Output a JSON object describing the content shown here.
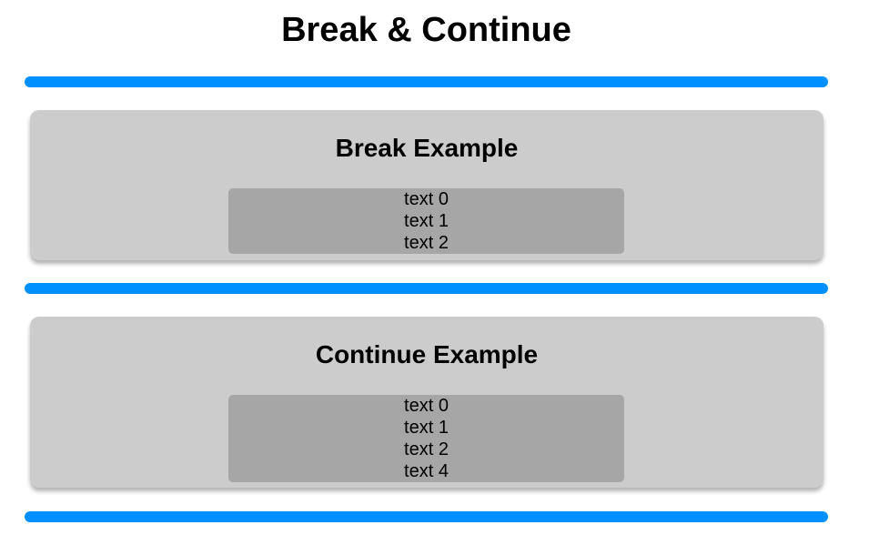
{
  "page": {
    "title": "Break & Continue"
  },
  "colors": {
    "divider": "#0090ff",
    "card_background": "#cccccc",
    "list_background": "#a6a6a6",
    "text": "#000000"
  },
  "break_section": {
    "title": "Break Example",
    "items": [
      "text 0",
      "text 1",
      "text 2"
    ]
  },
  "continue_section": {
    "title": "Continue Example",
    "items": [
      "text 0",
      "text 1",
      "text 2",
      "text 4"
    ]
  }
}
